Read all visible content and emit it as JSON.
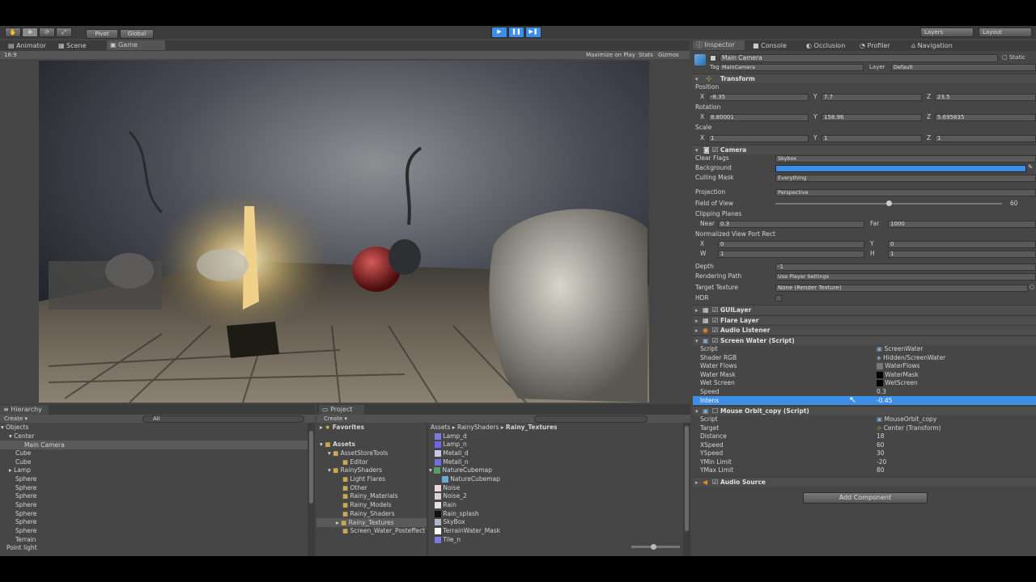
{
  "toolbar": {
    "pivot": "Pivot",
    "global": "Global",
    "layers": "Layers",
    "layout": "Layout"
  },
  "tabs_left": [
    "Animator",
    "Scene",
    "Game"
  ],
  "game": {
    "aspect": "16:9",
    "maximize": "Maximize on Play",
    "stats": "Stats",
    "gizmos": "Gizmos"
  },
  "tabs_right": [
    "Inspector",
    "Console",
    "Occlusion",
    "Profiler",
    "Navigation"
  ],
  "inspector": {
    "object_name": "Main Camera",
    "static": "Static",
    "tag_label": "Tag",
    "tag": "MainCamera",
    "layer_label": "Layer",
    "layer": "Default",
    "transform": {
      "title": "Transform",
      "position_label": "Position",
      "rotation_label": "Rotation",
      "scale_label": "Scale",
      "pos": [
        "-8.35",
        "7.7",
        "23.5"
      ],
      "rot": [
        "8.80001",
        "158.96",
        "5.695835"
      ],
      "scale": [
        "1",
        "1",
        "1"
      ],
      "x": "X",
      "y": "Y",
      "z": "Z"
    },
    "camera": {
      "title": "Camera",
      "clear_flags_label": "Clear Flags",
      "clear_flags": "Skybox",
      "background_label": "Background",
      "culling_label": "Culling Mask",
      "culling": "Everything",
      "projection_label": "Projection",
      "projection": "Perspective",
      "fov_label": "Field of View",
      "fov": "60",
      "fov_fraction": 0.5,
      "clipping_label": "Clipping Planes",
      "near_label": "Near",
      "near": "0.3",
      "far_label": "Far",
      "far": "1000",
      "viewport_label": "Normalized View Port Rect",
      "vx": "0",
      "vy": "0",
      "vw": "1",
      "vh": "1",
      "w": "W",
      "h": "H",
      "depth_label": "Depth",
      "depth": "-1",
      "rendering_label": "Rendering Path",
      "rendering": "Use Player Settings",
      "target_label": "Target Texture",
      "target": "None (Render Texture)",
      "hdr_label": "HDR"
    },
    "components": [
      "GUILayer",
      "Flare Layer",
      "Audio Listener"
    ],
    "screen_water": {
      "title": "Screen Water (Script)",
      "rows": [
        {
          "label": "Script",
          "value": "ScreenWater"
        },
        {
          "label": "Shader RGB",
          "value": "Hidden/ScreenWater"
        },
        {
          "label": "Water Flows",
          "value": "WaterFlows"
        },
        {
          "label": "Water Mask",
          "value": "WaterMask"
        },
        {
          "label": "Wet Screen",
          "value": "WetScreen"
        },
        {
          "label": "Speed",
          "value": "0.3"
        },
        {
          "label": "Intens",
          "value": "-0.45"
        }
      ]
    },
    "mouse_orbit": {
      "title": "Mouse Orbit_copy (Script)",
      "rows": [
        {
          "label": "Script",
          "value": "MouseOrbit_copy"
        },
        {
          "label": "Target",
          "value": "Center (Transform)"
        },
        {
          "label": "Distance",
          "value": "18"
        },
        {
          "label": "XSpeed",
          "value": "60"
        },
        {
          "label": "YSpeed",
          "value": "30"
        },
        {
          "label": "YMin Limit",
          "value": "-20"
        },
        {
          "label": "YMax Limit",
          "value": "80"
        }
      ]
    },
    "audio_source": "Audio Source",
    "add_component": "Add Component"
  },
  "hierarchy": {
    "tab": "Hierarchy",
    "create": "Create",
    "search": "All",
    "items": [
      "Objects",
      "Center",
      "Main Camera",
      "Cube",
      "Cube",
      "Lamp",
      "Sphere",
      "Sphere",
      "Sphere",
      "Sphere",
      "Sphere",
      "Sphere",
      "Sphere",
      "Terrain",
      "Point light"
    ]
  },
  "project": {
    "tab": "Project",
    "create": "Create",
    "favorites": "Favorites",
    "assets": "Assets",
    "tree": [
      "AssetStoreTools",
      "Editor",
      "RainyShaders",
      "Light Flares",
      "Other",
      "Rainy_Materials",
      "Rainy_Models",
      "Rainy_Shaders",
      "Rainy_Textures",
      "Screen_Water_Posteffect"
    ],
    "breadcrumb": [
      "Assets",
      "RainyShaders",
      "Rainy_Textures"
    ],
    "files": [
      "Lamp_d",
      "Lamp_n",
      "Metall_d",
      "Metall_n",
      "NatureCubemap",
      "NatureCubemap",
      "Noise",
      "Noise_2",
      "Rain",
      "Rain_splash",
      "SkyBox",
      "TerrainWater_Mask",
      "Tile_n"
    ]
  },
  "colors": {
    "accent": "#3d8ee6",
    "panel": "#464646"
  }
}
